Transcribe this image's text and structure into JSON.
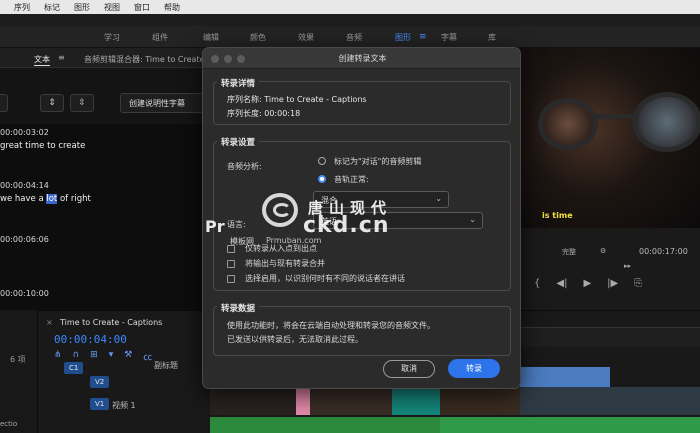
{
  "menubar": {
    "items": [
      "序列",
      "标记",
      "图形",
      "视图",
      "窗口",
      "帮助"
    ]
  },
  "workspace": {
    "tabs": [
      "学习",
      "组件",
      "编辑",
      "颜色",
      "效果",
      "音频",
      "图形",
      "字幕",
      "库"
    ],
    "active": "图形",
    "menu_icon": "≡"
  },
  "text_panel": {
    "tab": "文本",
    "tab_menu_icon": "≡",
    "audio_mixer_tab": "音频剪辑混合器: Time to Create",
    "create_captions_button": "创建说明性字幕",
    "entries": [
      {
        "timecode": "00:00:03:02",
        "text_before": "great time to create",
        "highlight": "",
        "text_after": ""
      },
      {
        "timecode": "00:00:04:14",
        "text_before": "we have a ",
        "highlight": "lot",
        "text_after": " of right"
      },
      {
        "timecode": "00:00:06:06",
        "text_before": "",
        "highlight": "",
        "text_after": ""
      },
      {
        "timecode": "00:00:10:00",
        "text_before": "",
        "highlight": "",
        "text_after": ""
      }
    ]
  },
  "program_monitor": {
    "caption": "is time",
    "timecode": "00:00:17:00",
    "zoom_label": "完整"
  },
  "timeline": {
    "sequence_tab": "Time to Create - Captions",
    "close_icon": "×",
    "timecode": "00:00:04:00",
    "items_count": "6 项",
    "subtitle_track": "副标题",
    "tracks": [
      {
        "id": "C1",
        "name": ""
      },
      {
        "id": "V2",
        "name": ""
      },
      {
        "id": "V1",
        "name": "视频 1"
      }
    ],
    "left_text": "ectio"
  },
  "dialog": {
    "title": "创建转录文本",
    "details": {
      "heading": "转录详情",
      "sequence_name_label": "序列名称:",
      "sequence_name": "Time to Create - Captions",
      "sequence_length_label": "序列长度:",
      "sequence_length": "00:00:18"
    },
    "settings": {
      "heading": "转录设置",
      "audio_analysis_label": "音频分析:",
      "option_dialogue": "标记为\"对话\"的音频剪辑",
      "option_track": "音轨正常:",
      "selected_option": "track",
      "track_value": "混合",
      "language_label": "语言:",
      "language_value": "英语",
      "checkboxes": [
        {
          "label": "仅转录从入点到出点",
          "checked": false
        },
        {
          "label": "将输出与现有转录合并",
          "checked": false
        },
        {
          "label": "选择启用，以识别何时有不同的说话者在讲话",
          "checked": false
        }
      ]
    },
    "data_section": {
      "heading": "转录数据",
      "line1": "使用此功能时，将会在云端自动处理和转录您的音频文件。",
      "line2": "已发送以供转录后，无法取消此过程。"
    },
    "cancel_label": "取消",
    "transcribe_label": "转录"
  },
  "watermark": {
    "chinese": "唐山现代",
    "domain": "ckd.cn",
    "prefix": "Pr",
    "sub": "模板网",
    "url": "Prmuban.com"
  },
  "colors": {
    "accent": "#2d74ea",
    "timecode": "#3b8aff",
    "caption_yellow": "#f4e23a",
    "highlight": "#3a65c9"
  }
}
